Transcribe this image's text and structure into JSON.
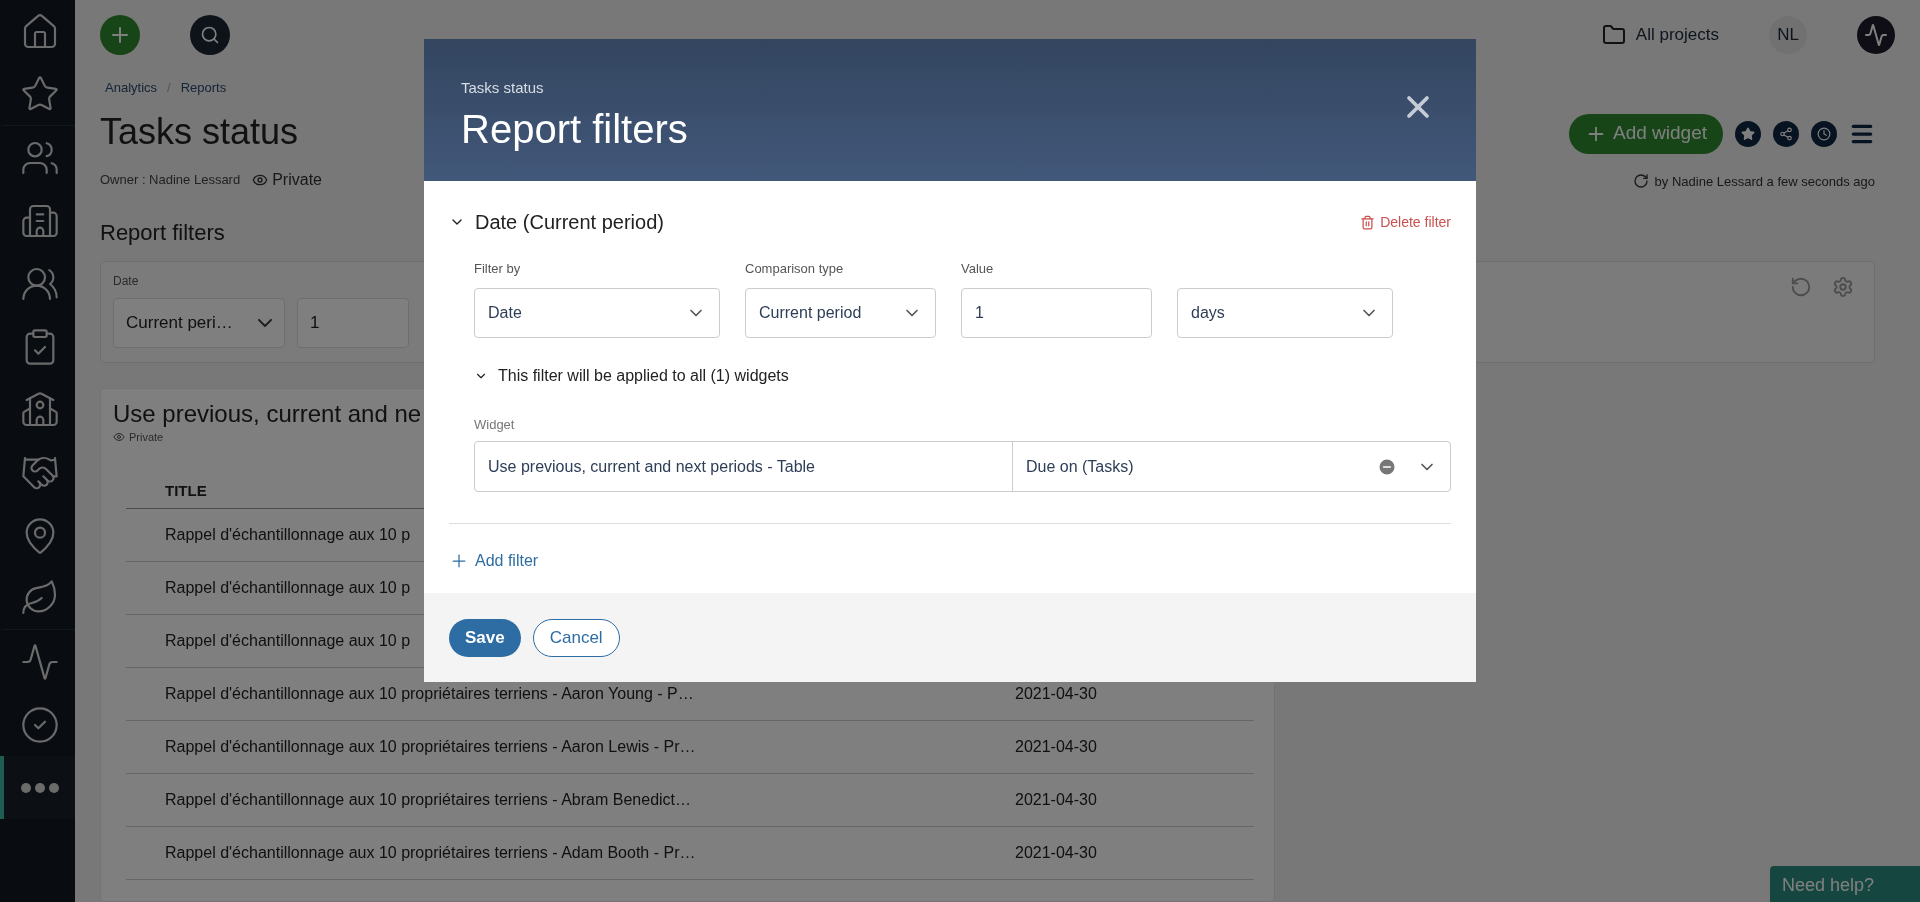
{
  "sidebar": {
    "items": [
      {
        "selected": false
      },
      {
        "selected": false
      },
      {
        "selected": false
      },
      {
        "selected": false
      },
      {
        "selected": false
      },
      {
        "selected": false
      },
      {
        "selected": false
      },
      {
        "selected": false
      },
      {
        "selected": false
      },
      {
        "selected": false
      },
      {
        "selected": false
      },
      {
        "selected": false
      },
      {
        "selected": true
      }
    ]
  },
  "topbar": {
    "projects": "All projects",
    "avatar": "NL"
  },
  "breadcrumb": {
    "items": [
      "Analytics",
      "Reports"
    ],
    "separator": "/"
  },
  "page": {
    "title": "Tasks status",
    "owner": "Owner : Nadine Lessard",
    "visibility": "Private",
    "add_widget": "Add widget",
    "updated": "by Nadine Lessard a few seconds ago"
  },
  "report_filters": {
    "heading": "Report filters",
    "label": "Date",
    "select": "Current peri…",
    "value": "1"
  },
  "widget": {
    "title": "Use previous, current and ne",
    "visibility": "Private",
    "columns": [
      "TITLE"
    ],
    "rows": [
      {
        "title": "Rappel d'échantillonnage aux 10 p"
      },
      {
        "title": "Rappel d'échantillonnage aux 10 p"
      },
      {
        "title": "Rappel d'échantillonnage aux 10 p"
      },
      {
        "title": "Rappel d'échantillonnage aux 10 propriétaires terriens - Aaron Young - P…",
        "date": "2021-04-30"
      },
      {
        "title": "Rappel d'échantillonnage aux 10 propriétaires terriens - Aaron Lewis - Pr…",
        "date": "2021-04-30"
      },
      {
        "title": "Rappel d'échantillonnage aux 10 propriétaires terriens - Abram Benedict…",
        "date": "2021-04-30"
      },
      {
        "title": "Rappel d'échantillonnage aux 10 propriétaires terriens - Adam Booth - Pr…",
        "date": "2021-04-30"
      }
    ]
  },
  "modal": {
    "subtitle": "Tasks status",
    "title": "Report filters",
    "filter": {
      "title": "Date (Current period)",
      "expanded": true,
      "delete": "Delete filter",
      "fields": [
        {
          "label": "Filter by",
          "value": "Date",
          "kind": "select"
        },
        {
          "label": "Comparison type",
          "value": "Current period",
          "kind": "select"
        },
        {
          "label": "Value",
          "value": "1",
          "kind": "input"
        },
        {
          "value": "days",
          "kind": "select"
        }
      ],
      "applies": {
        "text": "This filter will be applied to all (1) widgets",
        "expanded": true
      },
      "widget_label": "Widget",
      "widget_rows": [
        {
          "widget": "Use previous, current and next periods - Table",
          "field": "Due on (Tasks)"
        }
      ]
    },
    "add_filter": "Add filter",
    "save": "Save",
    "cancel": "Cancel"
  },
  "help": "Need help?"
}
